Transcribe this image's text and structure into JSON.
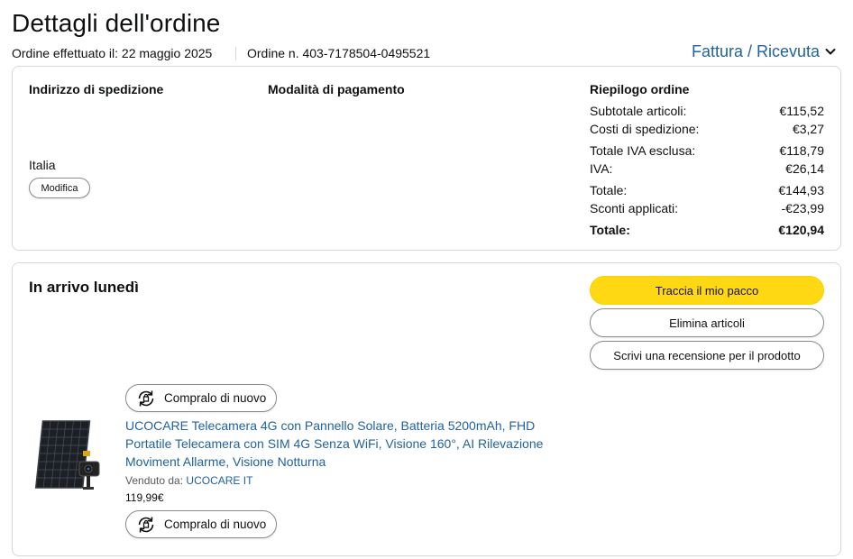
{
  "page": {
    "title": "Dettagli dell'ordine",
    "order_date": "Ordine effettuato il: 22 maggio 2025",
    "order_number": "Ordine n. 403-7178504-0495521",
    "invoice_link": "Fattura / Ricevuta"
  },
  "shipping": {
    "heading": "Indirizzo di spedizione",
    "country": "Italia",
    "edit_button": "Modifica"
  },
  "payment": {
    "heading": "Modalità di pagamento"
  },
  "summary": {
    "heading": "Riepilogo ordine",
    "rows": [
      {
        "label": "Subtotale articoli:",
        "value": "€115,52"
      },
      {
        "label": "Costi di spedizione:",
        "value": "€3,27"
      },
      {
        "label": "Totale IVA esclusa:",
        "value": "€118,79"
      },
      {
        "label": "IVA:",
        "value": "€26,14"
      },
      {
        "label": "Totale:",
        "value": "€144,93"
      },
      {
        "label": "Sconti applicati:",
        "value": "-€23,99"
      },
      {
        "label": "Totale:",
        "value": "€120,94"
      }
    ]
  },
  "shipment": {
    "status": "In arrivo lunedì",
    "track_button": "Traccia il mio pacco",
    "delete_button": "Elimina articoli",
    "review_button": "Scrivi una recensione per il prodotto",
    "buy_again_top": "Compralo di nuovo",
    "buy_again_bottom": "Compralo di nuovo",
    "product": {
      "title": "UCOCARE Telecamera 4G con Pannello Solare, Batteria 5200mAh, FHD Portatile Telecamera con SIM 4G Senza WiFi, Visione 160°, AI Rilevazione Moviment Allarme, Visione Notturna",
      "sold_by_label": "Venduto da:",
      "seller": "UCOCARE IT",
      "price": "119,99€"
    }
  },
  "colors": {
    "link": "#2162a1",
    "yellow_button": "#ffd814",
    "border": "#d5d9d9",
    "text": "#0f1111"
  }
}
